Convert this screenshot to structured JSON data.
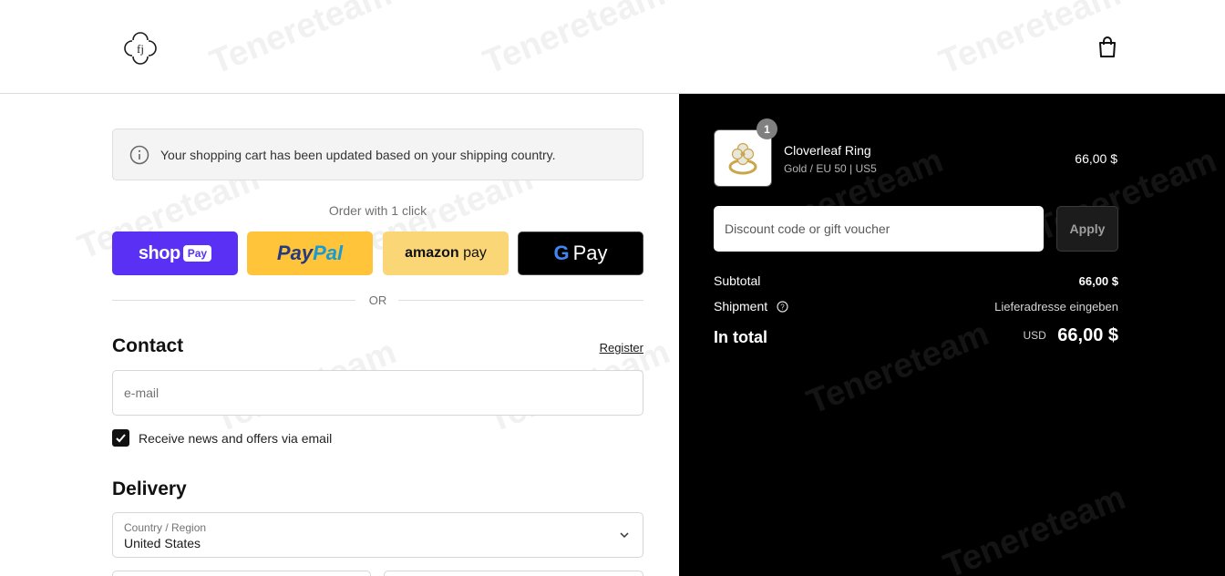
{
  "header": {
    "logo_text": "fj"
  },
  "watermark": "Tenereteam",
  "notice": {
    "text": "Your shopping cart has been updated based on your shipping country."
  },
  "express": {
    "title": "Order with 1 click",
    "shop_word": "shop",
    "shop_pay": "Pay",
    "paypal_a": "Pay",
    "paypal_b": "Pal",
    "amazon_a": "amazon",
    "amazon_b": " pay",
    "gpay_g": "G",
    "gpay_word": "Pay"
  },
  "or_label": "OR",
  "contact": {
    "title": "Contact",
    "register_link": "Register",
    "email_placeholder": "e-mail",
    "newsletter_label": "Receive news and offers via email",
    "newsletter_checked": true
  },
  "delivery": {
    "title": "Delivery",
    "country_label": "Country / Region",
    "country_value": "United States"
  },
  "summary": {
    "quantity": "1",
    "product_name": "Cloverleaf Ring",
    "product_variant": "Gold / EU 50 | US5",
    "product_price": "66,00 $",
    "discount_placeholder": "Discount code or gift voucher",
    "apply_label": "Apply",
    "subtotal_label": "Subtotal",
    "subtotal_value": "66,00 $",
    "shipment_label": "Shipment",
    "shipment_value": "Lieferadresse eingeben",
    "total_label": "In total",
    "total_currency": "USD",
    "total_value": "66,00 $"
  },
  "colors": {
    "shop_pay": "#5a31f4",
    "paypal": "#ffc439",
    "amazon_pay": "#fad676",
    "google_pay": "#000000",
    "summary_bg": "#000000"
  }
}
